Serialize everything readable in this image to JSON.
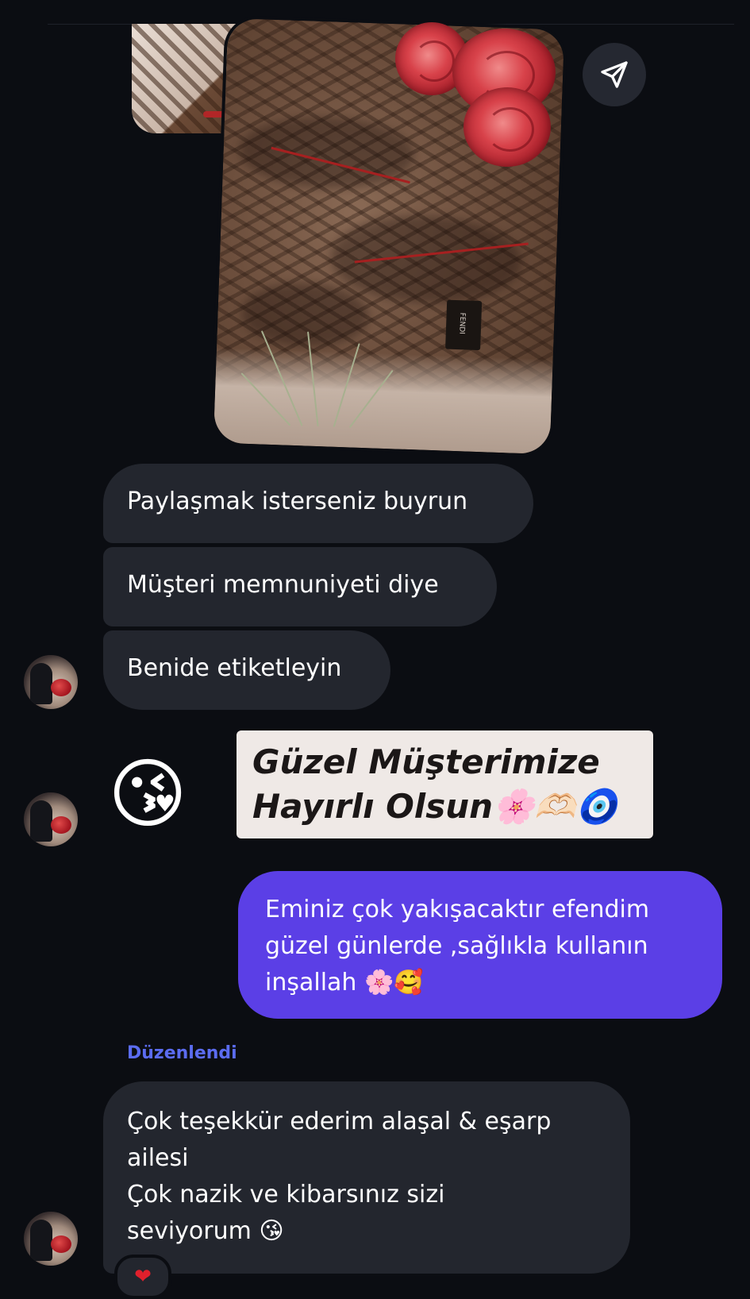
{
  "conversation": {
    "incoming_messages": [
      "Paylaşmak isterseniz buyrun",
      "Müşteri memnuniyeti diye",
      "Benide etiketleyin"
    ],
    "story_reply": {
      "emoji": "😘",
      "sticker_lines": [
        "Güzel Müşterimize",
        "Hayırlı Olsun🌸🫶🏻🧿"
      ]
    },
    "outgoing_message": {
      "lines": [
        "Eminiz çok yakışacaktır efendim",
        "güzel günlerde ,sağlıkla kullanın",
        "inşallah 🌸🥰"
      ]
    },
    "edited_label": "Düzenlendi",
    "last_message": {
      "lines": [
        "Çok teşekkür ederim alaşal & eşarp",
        "ailesi",
        "Çok nazik ve kibarsınız sizi",
        "seviyorum 😘"
      ]
    },
    "reaction": "❤"
  },
  "photo": {
    "tag_text": "FENDI"
  },
  "icons": {
    "share": "send-icon",
    "avatar": "avatar"
  },
  "colors": {
    "background": "#0b0d12",
    "incoming_bubble": "#23262e",
    "outgoing_bubble": "#5b3fe6",
    "edited_label": "#5b6cf0"
  }
}
